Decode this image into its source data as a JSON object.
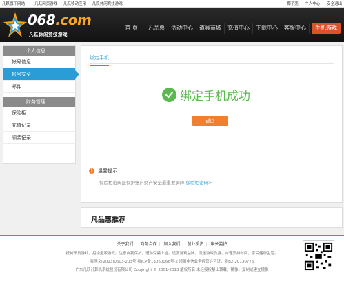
{
  "topbar": {
    "links": [
      "凡跃旗下网站：",
      "凡跃网页游戏",
      "凡跃移动应用",
      "凡跃休闲竞技游戏"
    ],
    "user": "椰子壳",
    "personal_center": "个人中心",
    "logout": "安全退出"
  },
  "logo": {
    "brand_prefix": "068",
    "brand_suffix": ".com",
    "slogan": "凡跃休闲竞技游戏"
  },
  "nav": {
    "items": [
      "首 页",
      "凡品惠",
      "活动中心",
      "道具商城",
      "充值中心",
      "下载中心",
      "客服中心"
    ],
    "mobile": "手机游戏"
  },
  "sidebar": {
    "section1": "个人信息",
    "items1": [
      "帐号信息",
      "帐号安全",
      "邮件"
    ],
    "section2": "财务管理",
    "items2": [
      "保险柜",
      "充值记录",
      "领奖记录"
    ]
  },
  "main": {
    "tab": "绑定手机",
    "success": "绑定手机成功",
    "return_button": "返回",
    "tip_title": "温馨提示",
    "tip_body": "保险柜密码是保护账户财产安全最重要屏障",
    "tip_link": "保险柜密码>"
  },
  "recommend": {
    "title": "凡品惠推荐"
  },
  "footer": {
    "links": [
      "关于我们",
      "商务合作",
      "加入我们",
      "创业投资",
      "家长监护"
    ],
    "line1": "抵制不良游戏，拒绝盗版游戏。注意自我保护，谨防受骗上当。适度游戏益脑，沉迷游戏伤身。合理安排时间，享受健康生活。",
    "line2": "粤网文[2013]0603-203号   粤ICP备13060066号-2   增值电信业务经营许可证：粤B2-20130776",
    "line3": "广东凡跃计算机系统股份有限公司 Copyright © 2001-2013 版权所有 未经授权禁止转载、镜像，复制或建立镜像"
  },
  "colors": {
    "accent_blue": "#2a9cd6",
    "success_green": "#5bb94f",
    "orange": "#f27f2e",
    "mobile_red": "#d9532b"
  }
}
